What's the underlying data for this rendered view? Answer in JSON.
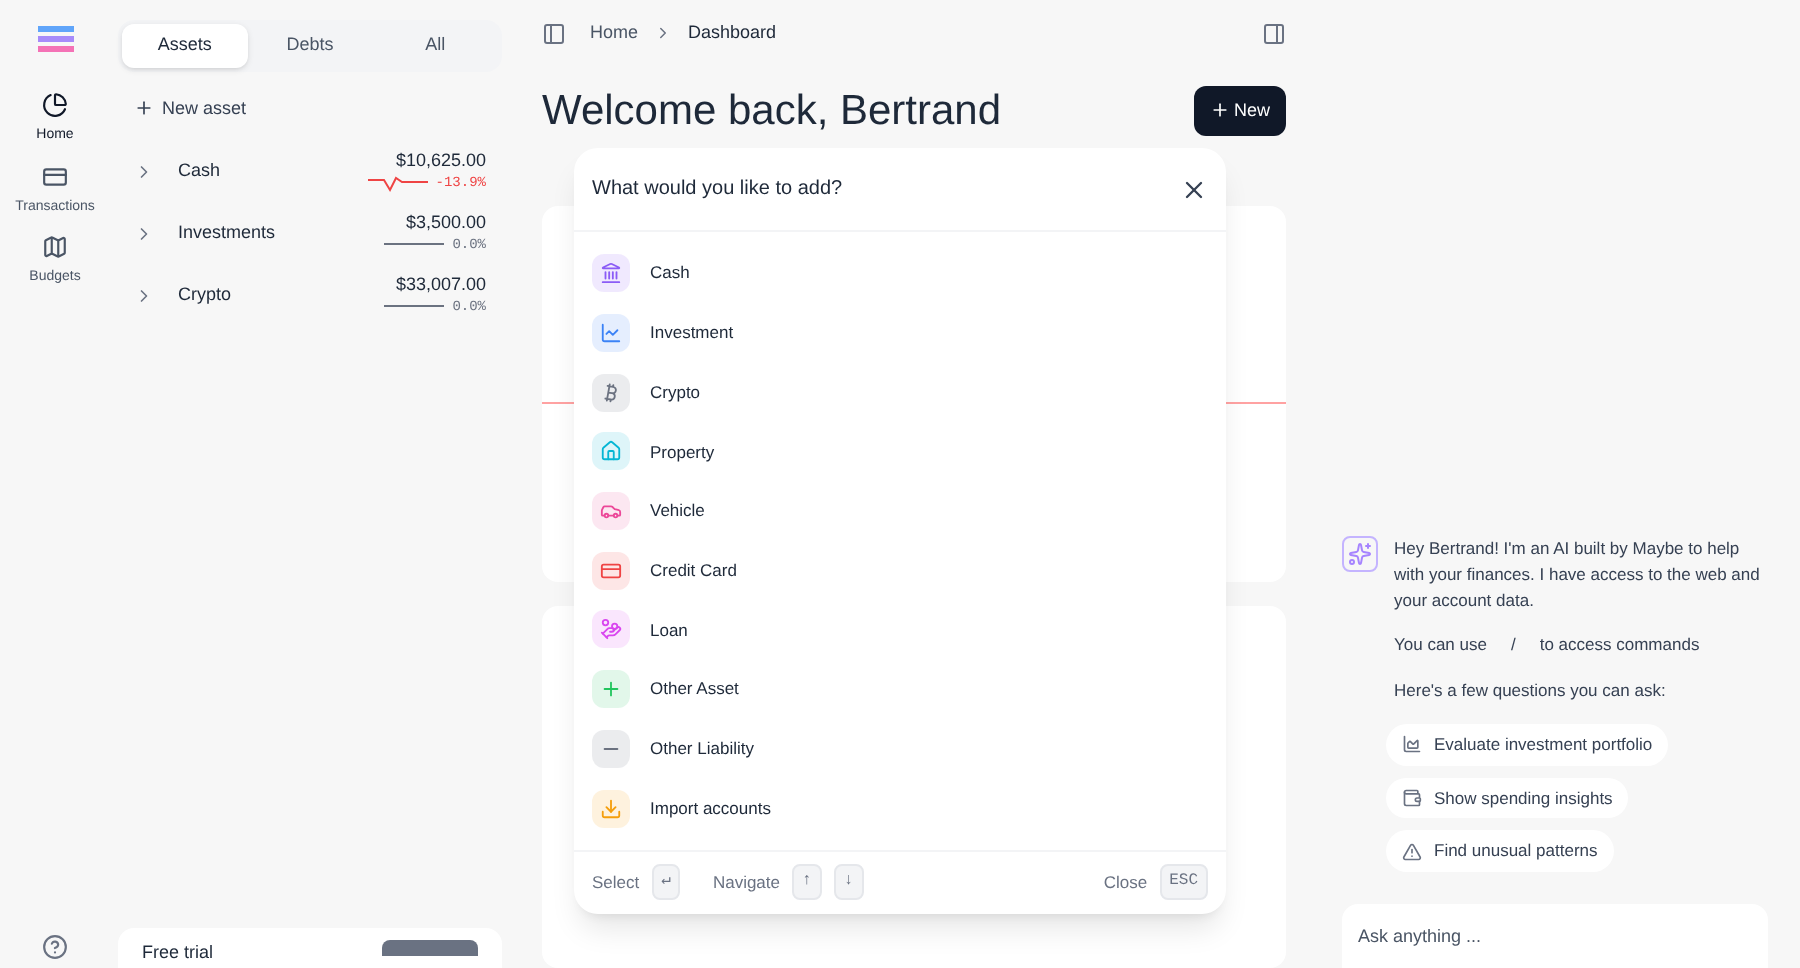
{
  "rail": {
    "items": [
      {
        "label": "Home",
        "selected": true
      },
      {
        "label": "Transactions",
        "selected": false
      },
      {
        "label": "Budgets",
        "selected": false
      }
    ]
  },
  "sidebar": {
    "tabs": [
      {
        "label": "Assets",
        "selected": true
      },
      {
        "label": "Debts",
        "selected": false
      },
      {
        "label": "All",
        "selected": false
      }
    ],
    "new_asset": "New asset",
    "accounts": [
      {
        "name": "Cash",
        "balance": "$10,625.00",
        "change": "-13.9%",
        "color": "#ef4444"
      },
      {
        "name": "Investments",
        "balance": "$3,500.00",
        "change": "0.0%",
        "color": "#6b7280"
      },
      {
        "name": "Crypto",
        "balance": "$33,007.00",
        "change": "0.0%",
        "color": "#6b7280"
      }
    ],
    "trial": {
      "label": "Free trial"
    }
  },
  "breadcrumb": [
    "Home",
    "Dashboard"
  ],
  "header": {
    "title": "Welcome back, Bertrand",
    "new_button": "New"
  },
  "dialog": {
    "title": "What would you like to add?",
    "items": [
      {
        "label": "Cash",
        "color": "#8b5cf6"
      },
      {
        "label": "Investment",
        "color": "#3b82f6"
      },
      {
        "label": "Crypto",
        "color": "#6b7280"
      },
      {
        "label": "Property",
        "color": "#06b6d4"
      },
      {
        "label": "Vehicle",
        "color": "#ec4899"
      },
      {
        "label": "Credit Card",
        "color": "#ef4444"
      },
      {
        "label": "Loan",
        "color": "#d946ef"
      },
      {
        "label": "Other Asset",
        "color": "#22c55e"
      },
      {
        "label": "Other Liability",
        "color": "#6b7280"
      },
      {
        "label": "Import accounts",
        "color": "#f59e0b"
      }
    ],
    "footer": [
      {
        "label": "Select",
        "keys": [
          "↵"
        ]
      },
      {
        "label": "Navigate",
        "keys": [
          "↑",
          "↓"
        ]
      }
    ],
    "close": {
      "label": "Close",
      "keys": [
        "ESC"
      ]
    }
  },
  "chat": {
    "intro": "Hey Bertrand! I'm an AI built by Maybe to help with your finances. I have access to the web and your account data.",
    "commands": {
      "before": "You can use",
      "key": "/",
      "after": "to access commands"
    },
    "questions_label": "Here's a few questions you can ask:",
    "suggestions": [
      {
        "label": "Evaluate investment portfolio"
      },
      {
        "label": "Show spending insights"
      },
      {
        "label": "Find unusual patterns"
      }
    ],
    "input": {
      "placeholder": "Ask anything ..."
    }
  }
}
